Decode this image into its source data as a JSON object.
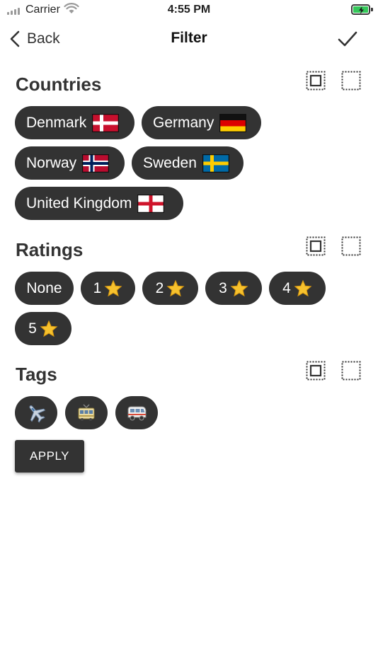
{
  "status_bar": {
    "carrier": "Carrier",
    "time": "4:55 PM",
    "signal_icon": "signal-bars-icon",
    "wifi_icon": "wifi-icon",
    "battery_icon": "battery-charging-icon"
  },
  "nav": {
    "back_label": "Back",
    "title": "Filter",
    "done_icon": "checkmark-icon"
  },
  "sections": {
    "countries": {
      "title": "Countries",
      "chips": [
        {
          "label": "Denmark",
          "flag": "denmark-flag-icon"
        },
        {
          "label": "Germany",
          "flag": "germany-flag-icon"
        },
        {
          "label": "Norway",
          "flag": "norway-flag-icon"
        },
        {
          "label": "Sweden",
          "flag": "sweden-flag-icon"
        },
        {
          "label": "United Kingdom",
          "flag": "england-flag-icon"
        }
      ]
    },
    "ratings": {
      "title": "Ratings",
      "chips": [
        {
          "label": "None"
        },
        {
          "label": "1",
          "icon": "star-icon"
        },
        {
          "label": "2",
          "icon": "star-icon"
        },
        {
          "label": "3",
          "icon": "star-icon"
        },
        {
          "label": "4",
          "icon": "star-icon"
        },
        {
          "label": "5",
          "icon": "star-icon"
        }
      ]
    },
    "tags": {
      "title": "Tags",
      "chips": [
        {
          "icon": "airplane-icon"
        },
        {
          "icon": "tram-icon"
        },
        {
          "icon": "minibus-icon"
        }
      ]
    }
  },
  "select_all_icon": "select-all-icon",
  "deselect_all_icon": "deselect-all-icon",
  "apply_label": "APPLY",
  "colors": {
    "chip_background": "#333333",
    "chip_text": "#ffffff",
    "text": "#333333",
    "battery_charging": "#34c759",
    "star": "#f7c22e"
  }
}
